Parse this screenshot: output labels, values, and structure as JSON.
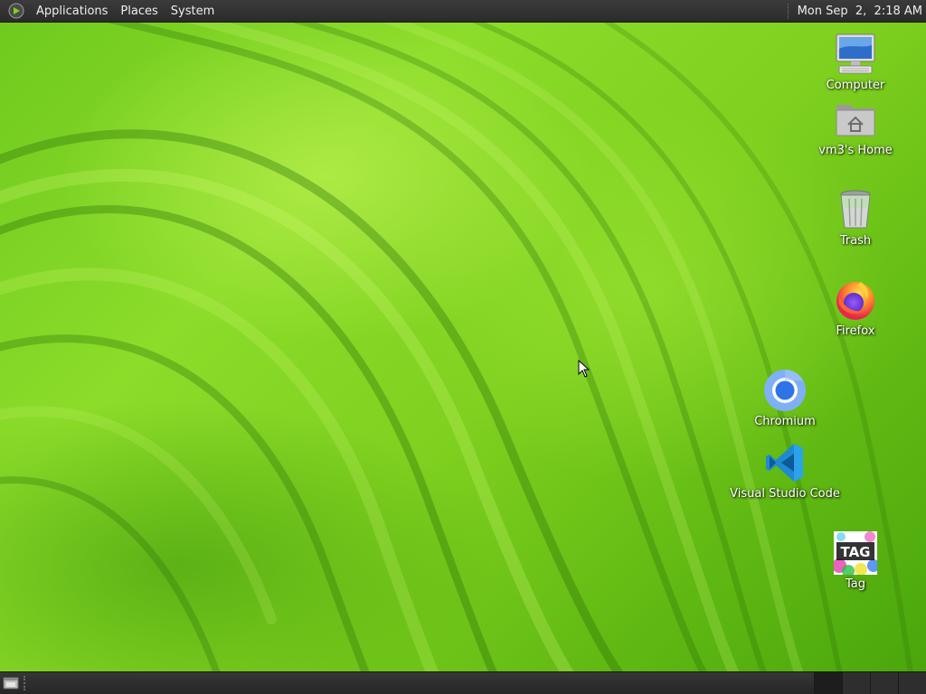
{
  "top_panel": {
    "menus": [
      "Applications",
      "Places",
      "System"
    ],
    "clock": "Mon Sep  2,  2:18 AM"
  },
  "desktop_icons": {
    "computer": {
      "label": "Computer",
      "icon": "computer-icon"
    },
    "home": {
      "label": "vm3's Home",
      "icon": "home-folder-icon"
    },
    "trash": {
      "label": "Trash",
      "icon": "trash-icon"
    },
    "firefox": {
      "label": "Firefox",
      "icon": "firefox-icon"
    },
    "chromium": {
      "label": "Chromium",
      "icon": "chromium-icon"
    },
    "vscode": {
      "label": "Visual Studio Code",
      "icon": "vscode-icon"
    },
    "tag": {
      "label": "Tag",
      "icon_text": "TAG",
      "icon": "tag-icon"
    }
  },
  "bottom_panel": {
    "show_desktop_icon": "show-desktop-icon",
    "workspaces": 4,
    "active_workspace": 1
  },
  "colors": {
    "panel": "#2b2b2b",
    "wallpaper_green": "#7fd01f",
    "vscode_blue": "#1f8ad2",
    "chromium_blue": "#4a8af4"
  }
}
